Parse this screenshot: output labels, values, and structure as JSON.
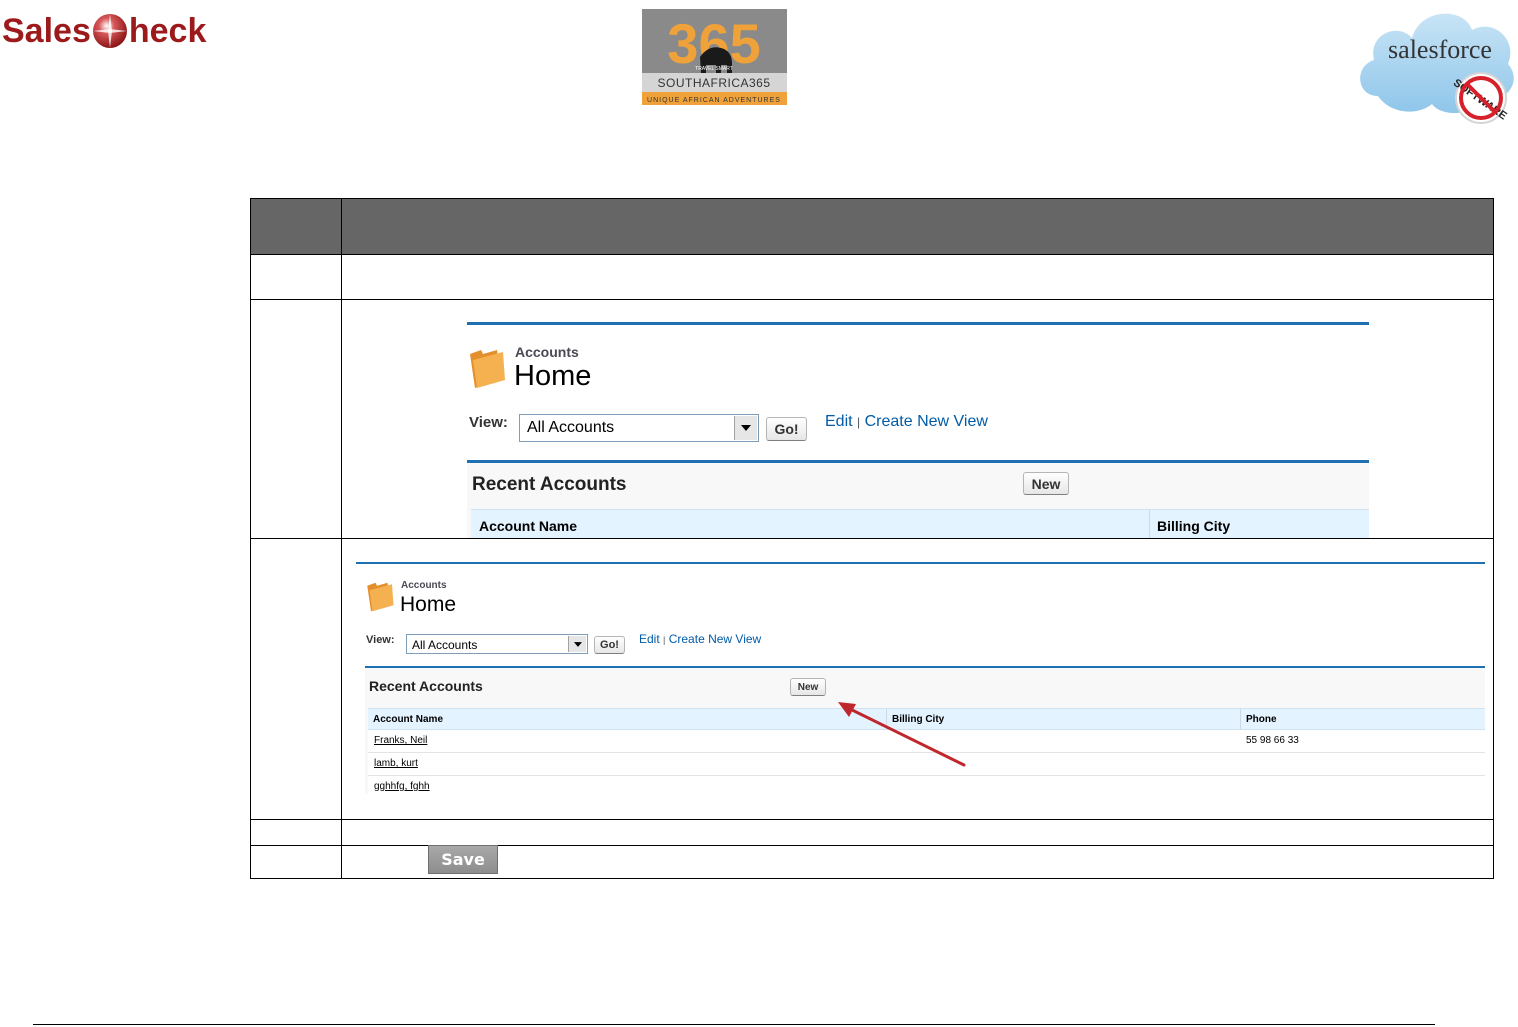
{
  "logos": {
    "salescheck_pre": "Sales",
    "salescheck_post": "heck",
    "sa365_top": "365",
    "sa365_tag": "TRAVEL SMART",
    "sa365_name": "SOUTHAFRICA365",
    "sa365_sub": "UNIQUE AFRICAN ADVENTURES",
    "salesforce": "salesforce",
    "no_software": "SOFTWARE"
  },
  "screenshot1": {
    "caption": "Accounts",
    "title": "Home",
    "view_label": "View:",
    "view_value": "All Accounts",
    "go_label": "Go!",
    "edit_link": "Edit",
    "separator": "|",
    "create_link": "Create New View",
    "panel_title": "Recent Accounts",
    "new_label": "New",
    "columns": [
      "Account Name",
      "Billing City"
    ]
  },
  "screenshot2": {
    "caption": "Accounts",
    "title": "Home",
    "view_label": "View:",
    "view_value": "All Accounts",
    "go_label": "Go!",
    "edit_link": "Edit",
    "separator": "|",
    "create_link": "Create New View",
    "panel_title": "Recent Accounts",
    "new_label": "New",
    "columns": [
      "Account Name",
      "Billing City",
      "Phone"
    ],
    "rows": [
      {
        "name": "Franks, Neil",
        "city": "",
        "phone": "55 98 66 33"
      },
      {
        "name": "lamb, kurt",
        "city": "",
        "phone": ""
      },
      {
        "name": "gghhfg, fghh",
        "city": "",
        "phone": ""
      }
    ]
  },
  "save_button": "Save",
  "colors": {
    "table_header": "#666666",
    "sf_blue": "#1f6fb3",
    "sf_link": "#015ba7",
    "salescheck_red": "#9c1a1c",
    "arrow_red": "#c0272d"
  }
}
